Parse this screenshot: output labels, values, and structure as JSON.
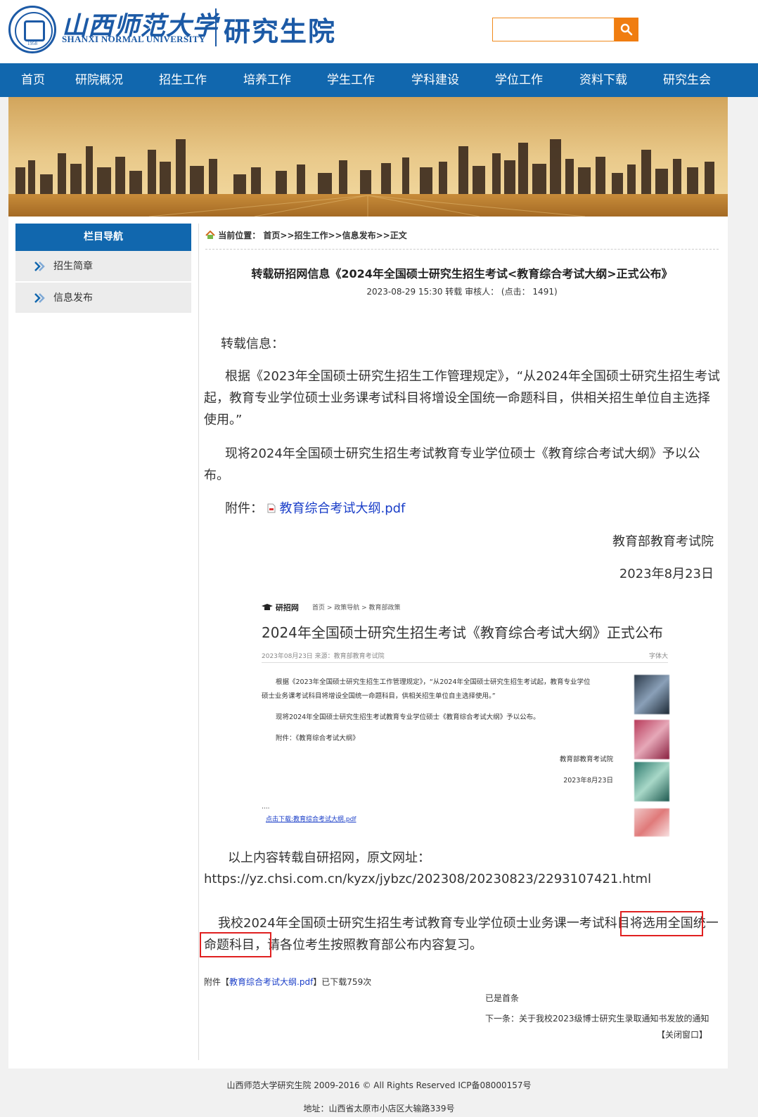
{
  "header": {
    "brand_cn": "山西师范大学",
    "brand_en": "SHANXI NORMAL UNIVERSITY",
    "dept": "研究生院",
    "seal_year": "1958",
    "search_placeholder": ""
  },
  "nav": [
    "首页",
    "研院概况",
    "招生工作",
    "培养工作",
    "学生工作",
    "学科建设",
    "学位工作",
    "资料下载",
    "研究生会"
  ],
  "sidebar": {
    "title": "栏目导航",
    "items": [
      "招生简章",
      "信息发布"
    ]
  },
  "breadcrumb": {
    "prefix": "当前位置：",
    "path": "首页>>招生工作>>信息发布>>正文"
  },
  "article": {
    "title": "转载研招网信息《2024年全国硕士研究生招生考试<教育综合考试大纲>正式公布》",
    "meta": "2023-08-29 15:30   转载 审核人：   (点击： 1491)",
    "p1": "转载信息：",
    "p2": "根据《2023年全国硕士研究生招生工作管理规定》，“从2024年全国硕士研究生招生考试起，教育专业学位硕士业务课考试科目将增设全国统一命题科目，供相关招生单位自主选择使用。”",
    "p3": "现将2024年全国硕士研究生招生考试教育专业学位硕士《教育综合考试大纲》予以公布。",
    "attach_label": "附件：",
    "attach_link": "教育综合考试大纲.pdf",
    "signer": "教育部教育考试院",
    "sign_date": "2023年8月23日",
    "source_label": "以上内容转载自研招网，原文网址：",
    "source_url": "https://yz.chsi.com.cn/kyzx/jybzc/202308/20230823/2293107421.html",
    "p_final_a": "我校2024年全国硕士研究生招生考试教育专业学位硕士业务课一考试科目",
    "p_final_b": "将选用全国统一命题科目",
    "p_final_c": "，请各位考生按照教育部公布内容复习。",
    "download_prefix": "附件【",
    "download_link": "教育综合考试大纲.pdf",
    "download_suffix": "】已下载759次",
    "prev": "已是首条",
    "next": "下一条：关于我校2023级博士研究生录取通知书发放的通知",
    "close": "【关闭窗口】"
  },
  "embedded": {
    "logo": "研招网",
    "crumb": "首页  >  政策导航  >  教育部政策",
    "title": "2024年全国硕士研究生招生考试《教育综合考试大纲》正式公布",
    "meta": "2023年08月23日   来源：教育部教育考试院",
    "font": "字体大",
    "p1": "根据《2023年全国硕士研究生招生工作管理规定》，“从2024年全国硕士研究生招生考试起，教育专业学位",
    "p1b": "硕士业务课考试科目将增设全国统一命题科目，供相关招生单位自主选择使用。”",
    "p2": "现将2024年全国硕士研究生招生考试教育专业学位硕士《教育综合考试大纲》予以公布。",
    "p3": "附件：《教育综合考试大纲》",
    "signer": "教育部教育考试院",
    "date": "2023年8月23日",
    "dots": "....",
    "link": "点击下载:教育综合考试大纲.pdf"
  },
  "footer": {
    "line1": "山西师范大学研究生院 2009-2016 ©  All Rights Reserved ICP备08000157号",
    "line2": "地址：山西省太原市小店区大输路339号"
  },
  "colors": {
    "brand_blue": "#1167ae",
    "search_orange": "#f07d10",
    "highlight_red": "#e02020"
  }
}
